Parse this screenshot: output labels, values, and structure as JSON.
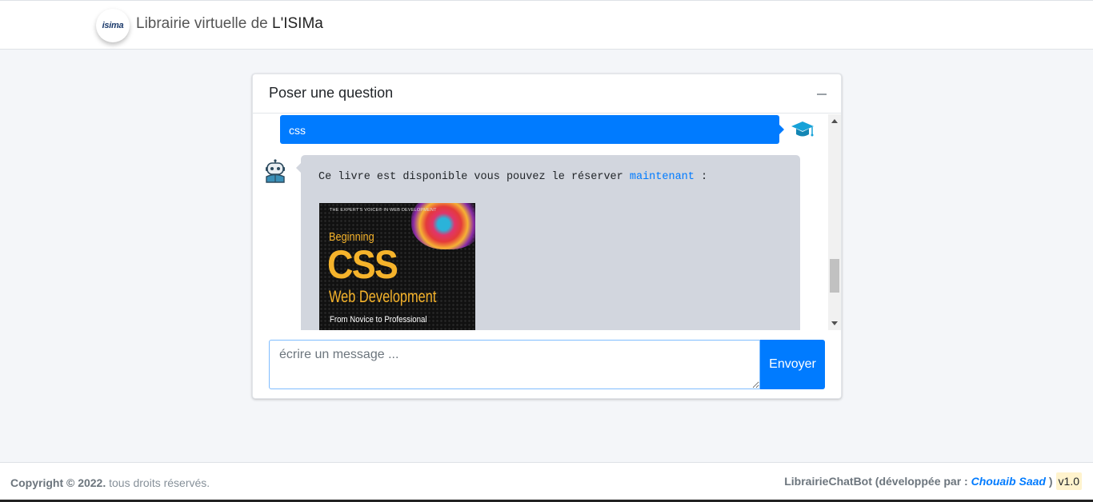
{
  "navbar": {
    "logo_text": "isima",
    "title_prefix": "Librairie virtuelle de ",
    "title_strong": "L'ISIMa"
  },
  "chat": {
    "header_title": "Poser une question",
    "collapse_icon": "minus-icon",
    "messages": [
      {
        "from": "user",
        "text": "css",
        "avatar_icon": "graduation-cap-icon"
      },
      {
        "from": "bot",
        "avatar_icon": "robot-icon",
        "text": "Ce livre est disponible vous pouvez le réserver ",
        "link": "maintenant",
        "text_after": " :",
        "book": {
          "tagline": "THE EXPERT'S VOICE® IN WEB DEVELOPMENT",
          "line1": "Beginning",
          "line2": "CSS",
          "line3": "Web Development",
          "line4": "From Novice to Professional"
        }
      }
    ],
    "input_placeholder": "écrire un message ...",
    "input_value": "",
    "send_label": "Envoyer"
  },
  "footer": {
    "copyright_strong": "Copyright © 2022.",
    "copyright_rest": " tous droits réservés.",
    "app_name": "LibrairieChatBot",
    "dev_prefix": " (développée par : ",
    "developer": "Chouaib Saad",
    "dev_suffix": " )",
    "version": "v1.0"
  },
  "colors": {
    "primary": "#007bff",
    "bot_bubble": "#d2d6de",
    "book_title": "#f5b32b"
  }
}
